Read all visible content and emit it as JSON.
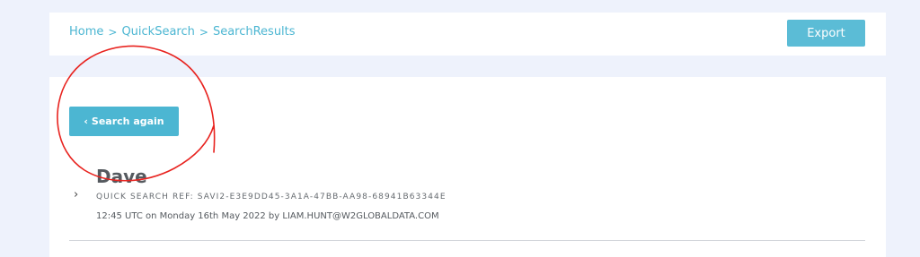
{
  "breadcrumb": {
    "items": [
      "Home",
      "QuickSearch",
      "SearchResults"
    ],
    "separator": ">"
  },
  "header": {
    "export_label": "Export"
  },
  "panel": {
    "search_again_label": "Search again",
    "result": {
      "title": "Dave",
      "ref": "QUICK SEARCH REF: SAVI2-E3E9DD45-3A1A-47BB-AA98-68941B63344E",
      "meta": "12:45 UTC on Monday 16th May 2022 by LIAM.HUNT@W2GLOBALDATA.COM"
    }
  },
  "colors": {
    "accent": "#4cb6d2",
    "background": "#eef2fc",
    "annotation": "#e8231f"
  },
  "icons": {
    "search_again": "chevron-left-icon",
    "expand": "chevron-right-icon"
  }
}
